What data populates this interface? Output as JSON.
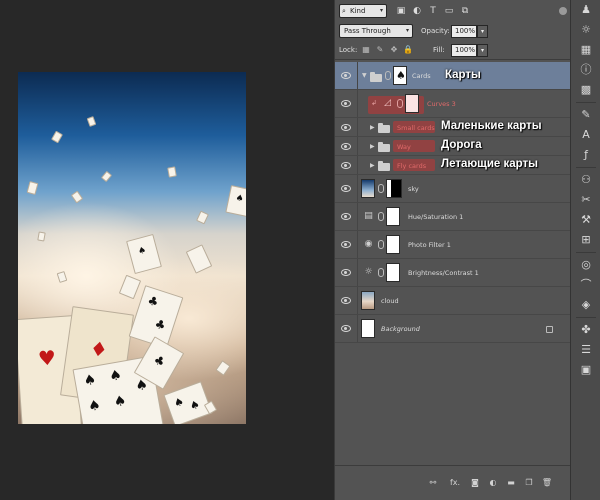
{
  "filter": {
    "kind_label": "Kind"
  },
  "blend": {
    "mode": "Pass Through",
    "opacity_label": "Opacity:",
    "opacity_value": "100%"
  },
  "lock": {
    "label": "Lock:",
    "fill_label": "Fill:",
    "fill_value": "100%"
  },
  "layers": [
    {
      "name": "Cards",
      "annotation": "Карты"
    },
    {
      "name": "Curves 3"
    },
    {
      "name": "Small cards",
      "annotation": "Маленькие карты"
    },
    {
      "name": "Way",
      "annotation": "Дорога"
    },
    {
      "name": "Fly cards",
      "annotation": "Летающие карты"
    },
    {
      "name": "sky"
    },
    {
      "name": "Hue/Saturation 1"
    },
    {
      "name": "Photo Filter 1"
    },
    {
      "name": "Brightness/Contrast 1"
    },
    {
      "name": "cloud"
    },
    {
      "name": "Background"
    }
  ],
  "bottom": {
    "fx_label": "fx."
  },
  "colors": {
    "selected_row": "#6d7f9a",
    "highlight": "#c43434",
    "panel": "#535353"
  },
  "icons": {
    "bottom": [
      "link-icon",
      "fx-icon",
      "mask-icon",
      "adjustment-icon",
      "group-icon",
      "new-layer-icon",
      "trash-icon"
    ],
    "toolbar": [
      "history-icon",
      "adjustments-icon",
      "swatches-icon",
      "info-icon",
      "grid-icon",
      "text-icon",
      "paragraph-icon",
      "brush-icon",
      "clone-icon",
      "color-icon",
      "paths-icon",
      "channels-icon",
      "tool-presets-icon",
      "layer-comps-icon"
    ]
  }
}
